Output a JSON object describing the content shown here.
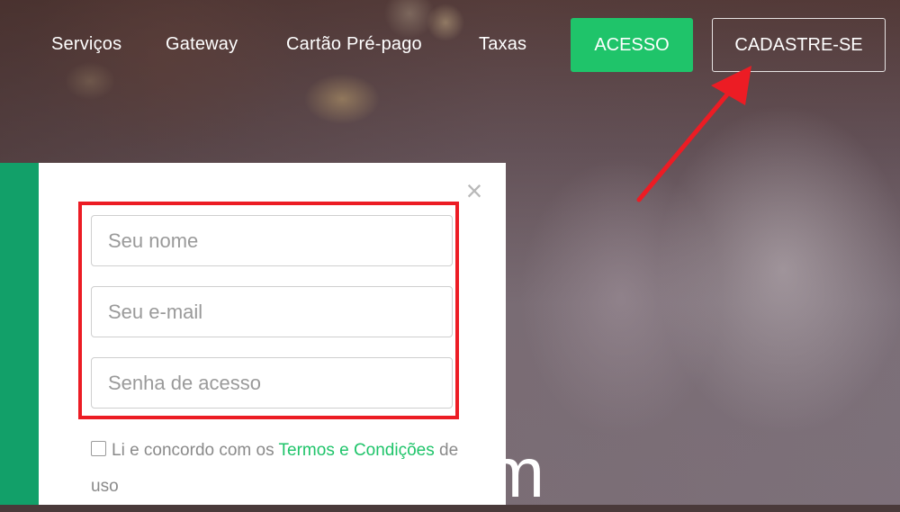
{
  "nav": {
    "links": [
      "Serviços",
      "Gateway",
      "Cartão Pré-pago",
      "Taxas"
    ],
    "acesso_label": "ACESSO",
    "cadastre_label": "CADASTRE-SE"
  },
  "modal": {
    "close_icon": "×",
    "name_placeholder": "Seu nome",
    "email_placeholder": "Seu e-mail",
    "password_placeholder": "Senha de acesso",
    "terms_prefix": "Li e concordo com os ",
    "terms_link": "Termos e Condições",
    "terms_suffix": " de uso"
  },
  "hero": {
    "text_fragment": "m"
  },
  "colors": {
    "accent_green": "#1fc46a",
    "sidebar_green": "#12a069",
    "highlight_red": "#ec1c24"
  }
}
